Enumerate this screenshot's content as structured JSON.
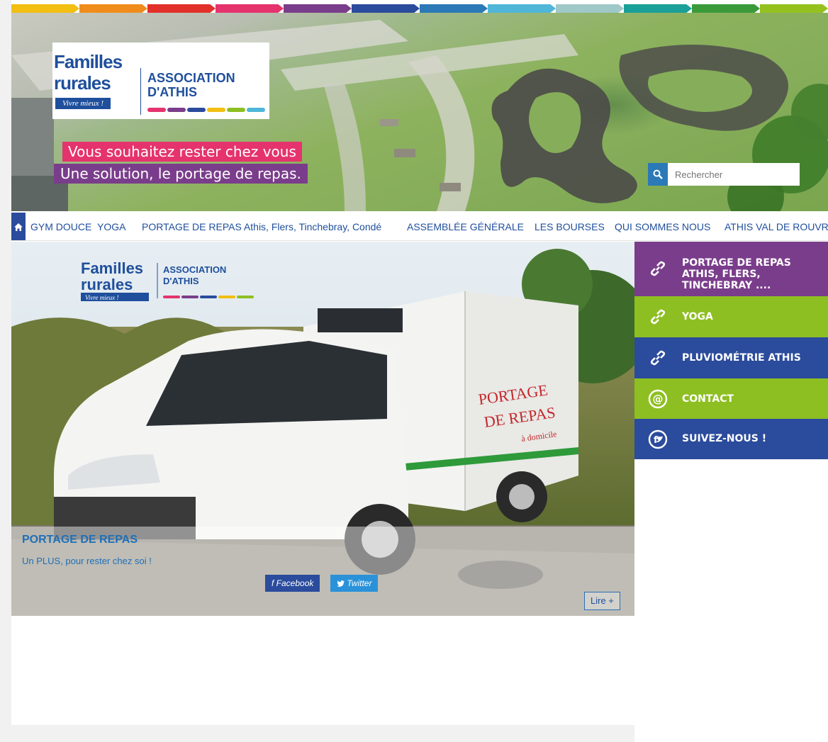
{
  "colors": {
    "band": [
      "#f2bf12",
      "#f08c1c",
      "#e2302b",
      "#e5336e",
      "#7a3d8b",
      "#2b4b9c",
      "#2b79b6",
      "#4fb6d8",
      "#9fc8c8",
      "#1aa098",
      "#3a9a3a",
      "#95c11f"
    ],
    "nav_text": "#1f4f9c",
    "portage": "#7a3d8b",
    "yoga": "#8ebf22",
    "pluvio": "#2b4b9c",
    "contact": "#8ebf22",
    "suivez": "#2b4b9c"
  },
  "header": {
    "logo": {
      "line1": "Familles",
      "line2": "rurales",
      "tagline": "Vivre mieux !",
      "assoc_line1": "ASSOCIATION",
      "assoc_line2": "D'ATHIS"
    },
    "tagline1": "Vous souhaitez rester chez vous",
    "tagline2": "Une solution, le portage de repas.",
    "search": {
      "icon": "search-icon",
      "placeholder": "Rechercher"
    }
  },
  "nav": {
    "home_icon": "home-icon",
    "items": [
      "GYM DOUCE",
      "YOGA",
      "PORTAGE DE REPAS Athis, Flers, Tinchebray, Condé",
      "ASSEMBLÉE GÉNÉRALE",
      "LES BOURSES",
      "QUI SOMMES NOUS",
      "ATHIS VAL DE ROUVRE"
    ]
  },
  "slider": {
    "caption_title": "PORTAGE DE REPAS",
    "caption_text": "Un PLUS, pour rester chez soi !",
    "facebook_label": "f Facebook",
    "twitter_label": "Twitter",
    "read_more": "Lire +",
    "van": {
      "logo_line1": "Familles",
      "logo_line2": "rurales",
      "logo_tagline": "Vivre mieux !",
      "assoc_line1": "ASSOCIATION",
      "assoc_line2": "D'ATHIS",
      "box_text1": "PORTAGE",
      "box_text2": "DE REPAS",
      "box_text3": "à domicile"
    }
  },
  "sidebar": {
    "items": [
      {
        "label": "PORTAGE DE REPAS ATHIS, FLERS, TINCHEBRAY ....",
        "icon": "link-icon"
      },
      {
        "label": "YOGA",
        "icon": "link-icon"
      },
      {
        "label": "PLUVIOMÉTRIE ATHIS",
        "icon": "link-icon"
      },
      {
        "label": "CONTACT",
        "icon": "at-icon"
      },
      {
        "label": "SUIVEZ-NOUS !",
        "icon": "social-icon"
      }
    ]
  }
}
